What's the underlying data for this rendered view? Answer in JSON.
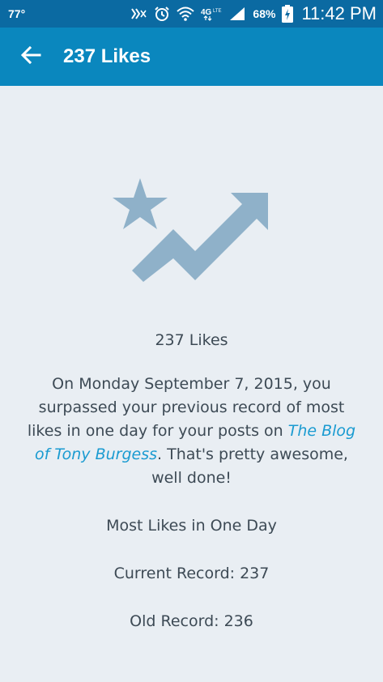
{
  "status_bar": {
    "temperature": "77°",
    "battery_percent": "68%",
    "time": "11:42 PM",
    "icons": [
      "nfc-icon",
      "mute-icon",
      "alarm-icon",
      "wifi-icon",
      "4g-lte-icon",
      "signal-icon",
      "battery-charging-icon"
    ]
  },
  "app_bar": {
    "title": "237 Likes",
    "back_icon": "arrow-back-icon"
  },
  "achievement": {
    "icon": "trending-up-star-icon",
    "heading": "237 Likes",
    "description_before_link": "On Monday September 7, 2015, you surpassed your previous record of most likes in one day for your posts on ",
    "blog_link": "The Blog of Tony Burgess",
    "description_after_link": ". That's pretty awesome, well done!",
    "stat_label": "Most Likes in One Day",
    "current_record": "Current Record: 237",
    "old_record": "Old Record: 236"
  },
  "colors": {
    "status_bar": "#0b6aa2",
    "app_bar": "#0a87be",
    "background": "#e9eef3",
    "icon": "#8fb1c9",
    "text": "#3d4a55",
    "link": "#1a9bd1"
  }
}
